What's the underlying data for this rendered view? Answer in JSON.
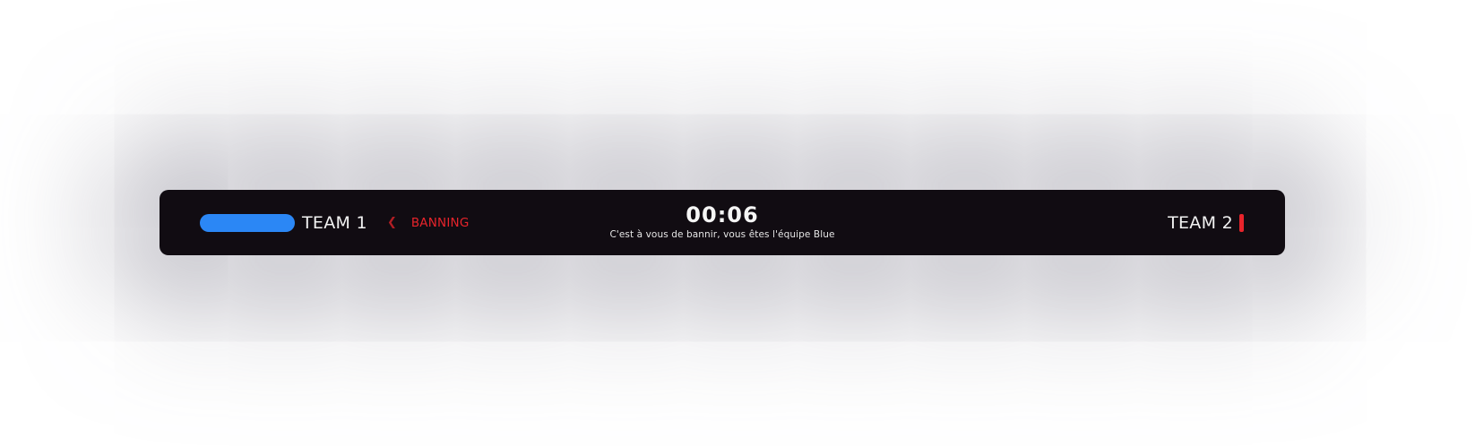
{
  "colors": {
    "team1": "#2b87f5",
    "team2": "#e8242b",
    "phase": "#e8242b"
  },
  "team1": {
    "name": "TEAM 1"
  },
  "phase": {
    "arrow_icon": "chevron-left-icon",
    "label": "BANNING"
  },
  "timer": {
    "value": "00:06",
    "message": "C'est à vous de bannir, vous êtes l'équipe Blue"
  },
  "team2": {
    "name": "TEAM 2"
  }
}
